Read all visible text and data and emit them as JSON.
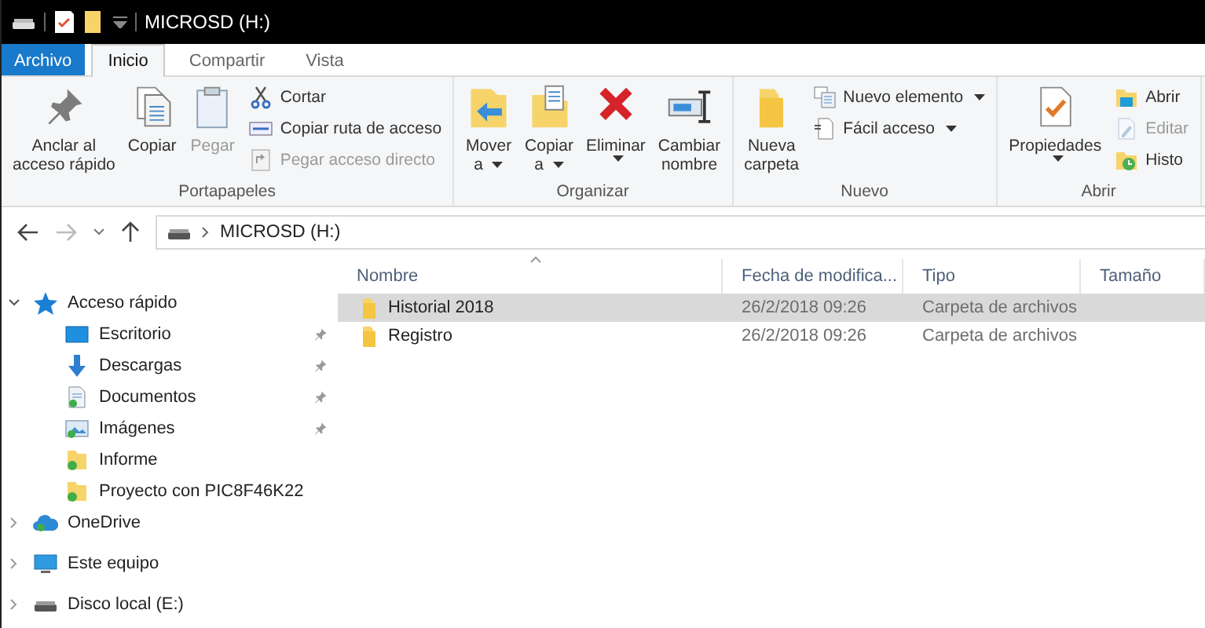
{
  "window": {
    "title": "MICROSD (H:)"
  },
  "tabs": [
    {
      "label": "Archivo",
      "kind": "file",
      "selected": false
    },
    {
      "label": "Inicio",
      "kind": "tab",
      "selected": true
    },
    {
      "label": "Compartir",
      "kind": "tab",
      "selected": false
    },
    {
      "label": "Vista",
      "kind": "tab",
      "selected": false
    }
  ],
  "ribbon": {
    "groups": [
      {
        "label": "Portapapeles",
        "large": [
          {
            "lines": [
              "Anclar al",
              "acceso rápido"
            ],
            "disabled": false,
            "dropdown": false
          },
          {
            "lines": [
              "Copiar"
            ],
            "disabled": false,
            "dropdown": false
          },
          {
            "lines": [
              "Pegar"
            ],
            "disabled": true,
            "dropdown": false
          }
        ],
        "small": [
          {
            "label": "Cortar",
            "disabled": false,
            "dropdown": false
          },
          {
            "label": "Copiar ruta de acceso",
            "disabled": false,
            "dropdown": false
          },
          {
            "label": "Pegar acceso directo",
            "disabled": true,
            "dropdown": false
          }
        ]
      },
      {
        "label": "Organizar",
        "large": [
          {
            "lines": [
              "Mover",
              "a"
            ],
            "disabled": false,
            "dropdown": true
          },
          {
            "lines": [
              "Copiar",
              "a"
            ],
            "disabled": false,
            "dropdown": true
          },
          {
            "lines": [
              "Eliminar"
            ],
            "disabled": false,
            "dropdown": true
          },
          {
            "lines": [
              "Cambiar",
              "nombre"
            ],
            "disabled": false,
            "dropdown": false
          }
        ]
      },
      {
        "label": "Nuevo",
        "large": [
          {
            "lines": [
              "Nueva",
              "carpeta"
            ],
            "disabled": false,
            "dropdown": false
          }
        ],
        "small": [
          {
            "label": "Nuevo elemento",
            "disabled": false,
            "dropdown": true
          },
          {
            "label": "Fácil acceso",
            "disabled": false,
            "dropdown": true
          }
        ]
      },
      {
        "label": "Abrir",
        "large": [
          {
            "lines": [
              "Propiedades"
            ],
            "disabled": false,
            "dropdown": true
          }
        ],
        "small": [
          {
            "label": "Abrir",
            "disabled": false,
            "dropdown": false
          },
          {
            "label": "Editar",
            "disabled": true,
            "dropdown": false
          },
          {
            "label": "Histo",
            "disabled": false,
            "dropdown": false
          }
        ]
      }
    ]
  },
  "address_bar": {
    "path": "MICROSD (H:)",
    "forward_disabled": true
  },
  "navigation": [
    {
      "label": "Acceso rápido",
      "expanded": true,
      "children": [
        {
          "label": "Escritorio",
          "pinned": true
        },
        {
          "label": "Descargas",
          "pinned": true
        },
        {
          "label": "Documentos",
          "pinned": true
        },
        {
          "label": "Imágenes",
          "pinned": true
        },
        {
          "label": "Informe",
          "pinned": false
        },
        {
          "label": "Proyecto con PIC8F46K22",
          "pinned": false
        }
      ]
    },
    {
      "label": "OneDrive",
      "expanded": false
    },
    {
      "label": "Este equipo",
      "expanded": false
    },
    {
      "label": "Disco local (E:)",
      "expanded": false
    }
  ],
  "table": {
    "columns": [
      {
        "label": "Nombre",
        "sorted": true
      },
      {
        "label": "Fecha de modifica...",
        "sorted": false
      },
      {
        "label": "Tipo",
        "sorted": false
      },
      {
        "label": "Tamaño",
        "sorted": false
      }
    ],
    "rows": [
      {
        "name": "Historial 2018",
        "date": "26/2/2018 09:26",
        "type": "Carpeta de archivos",
        "selected": true
      },
      {
        "name": "Registro",
        "date": "26/2/2018 09:26",
        "type": "Carpeta de archivos",
        "selected": false
      }
    ]
  }
}
